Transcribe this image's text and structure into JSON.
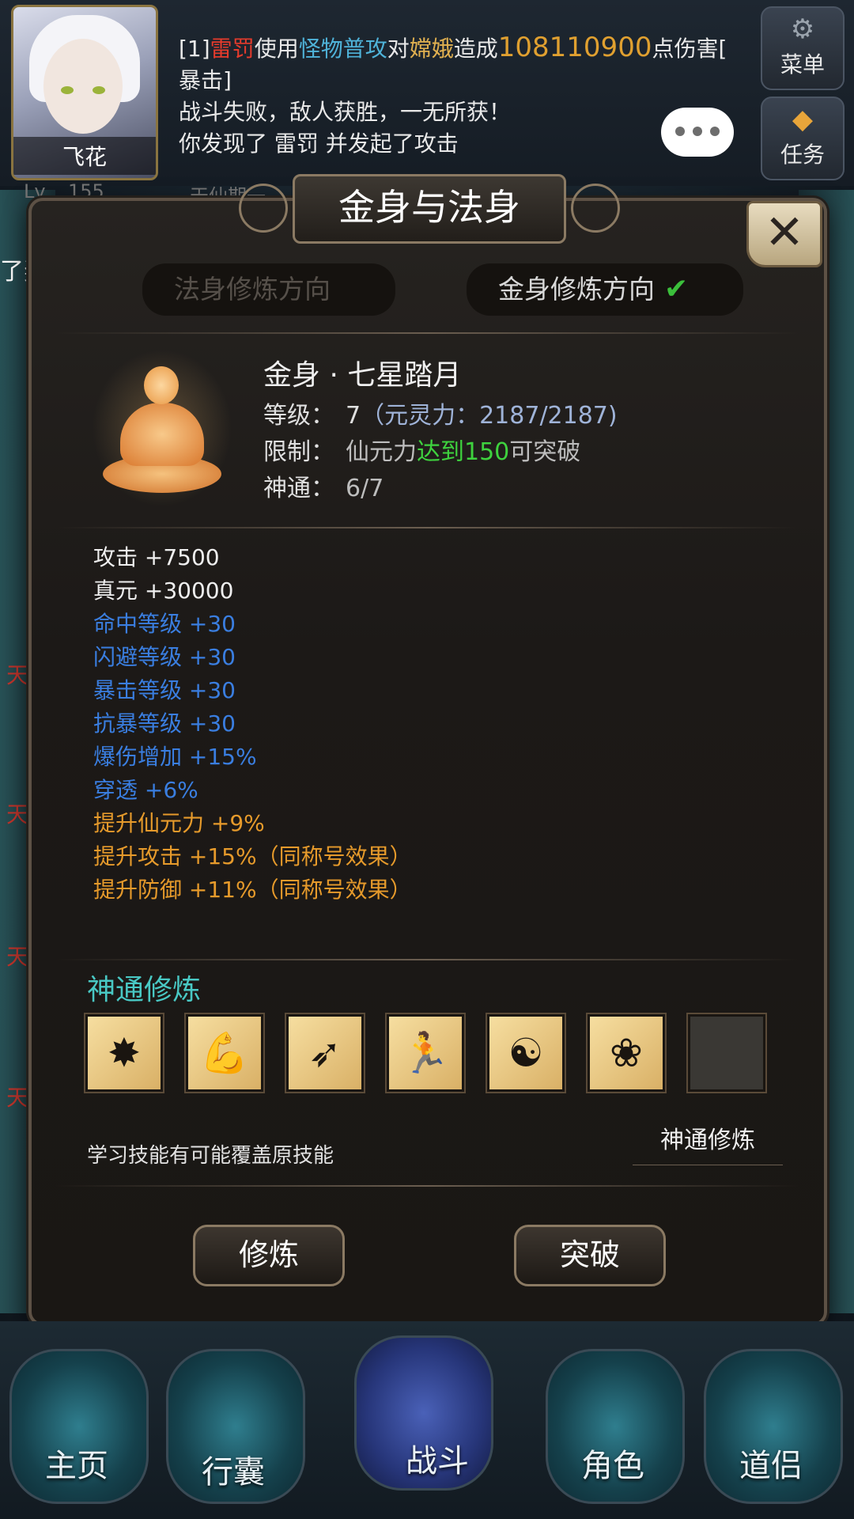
{
  "player": {
    "name": "飞花"
  },
  "log": {
    "line1_prefix": "[1]",
    "line1_attacker": "雷罚",
    "line1_use": "使用",
    "line1_skill": "怪物普攻",
    "line1_to": "对",
    "line1_target": "嫦娥",
    "line1_cause": "造成",
    "line1_damage": "108110900",
    "line1_suffix": "点伤害[",
    "line2": "暴击]",
    "line3": "战斗失败，敌人获胜，一无所获！",
    "line4": "你发现了 雷罚 并发起了攻击"
  },
  "side_buttons": {
    "menu": "菜单",
    "task": "任务"
  },
  "background": {
    "reward_text": "了奖励",
    "level_text": "155",
    "stage_text": "天仙期一",
    "red_chars": [
      "天",
      "天",
      "天",
      "天"
    ]
  },
  "dialog": {
    "title": "金身与法身",
    "tabs": {
      "fashen": "法身修炼方向",
      "jinshen": "金身修炼方向"
    },
    "body_name": "金身 · 七星踏月",
    "level_label": "等级：",
    "level_value": "7",
    "level_sub": "（元灵力：2187/2187)",
    "limit_label": "限制：",
    "limit_pre": "仙元力",
    "limit_green": "达到150",
    "limit_post": "可突破",
    "shentong_label": "神通：",
    "shentong_value": "6/7",
    "attributes": {
      "white": [
        "攻击 +7500",
        "真元 +30000"
      ],
      "blue": [
        "命中等级 +30",
        "闪避等级 +30",
        "暴击等级 +30",
        "抗暴等级 +30",
        "爆伤增加 +15%",
        "穿透 +6%"
      ],
      "orange": [
        "提升仙元力 +9%",
        "提升攻击 +15%（同称号效果）",
        "提升防御 +11%（同称号效果）"
      ]
    },
    "skills_title": "神通修炼",
    "skills_tip": "学习技能有可能覆盖原技能",
    "skills_train_link": "神通修炼",
    "btn_train": "修炼",
    "btn_break": "突破"
  },
  "nav": {
    "home": "主页",
    "bag": "行囊",
    "battle": "战斗",
    "role": "角色",
    "partner": "道侣"
  },
  "colors": {
    "accent_cyan": "#49c8c4",
    "blue_attr": "#3a7ee0",
    "orange_attr": "#e69a2b",
    "green": "#3ed23e"
  }
}
